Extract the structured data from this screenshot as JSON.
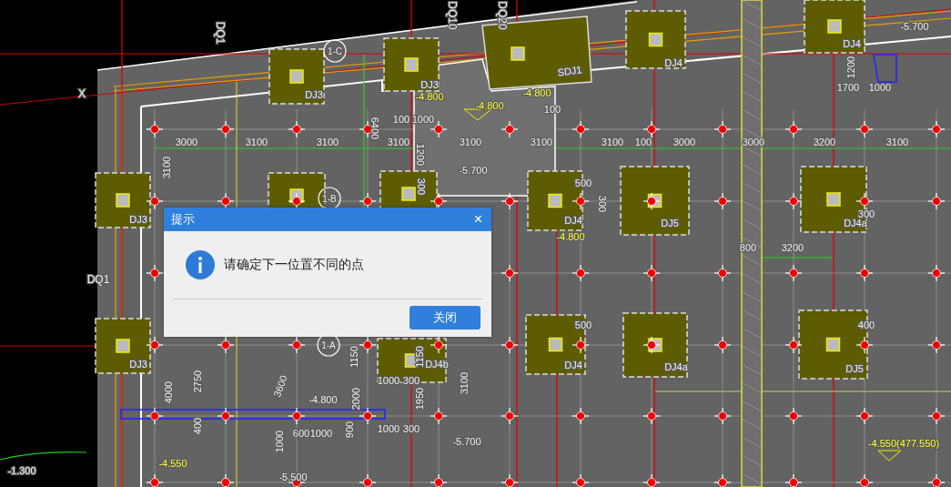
{
  "drawing": {
    "labels": [
      {
        "kind": "tag",
        "text": "DQ1"
      },
      {
        "kind": "tag",
        "text": "DQ10"
      },
      {
        "kind": "tag",
        "text": "DQ20"
      },
      {
        "kind": "tag",
        "text": "X"
      },
      {
        "kind": "axis",
        "text": "1-C"
      },
      {
        "kind": "footing",
        "text": "DJ3"
      },
      {
        "kind": "footing",
        "text": "DJ3"
      },
      {
        "kind": "footing",
        "text": "SDJ1"
      },
      {
        "kind": "footing",
        "text": "DJ4"
      },
      {
        "kind": "footing",
        "text": "DJ4"
      },
      {
        "kind": "level_white",
        "text": "-5.700"
      },
      {
        "kind": "level_yellow",
        "text": "-4.800"
      },
      {
        "kind": "level_yellow",
        "text": "-4.800"
      },
      {
        "kind": "level_yellow",
        "text": "-4.800"
      },
      {
        "kind": "dimension",
        "text": "1200"
      },
      {
        "kind": "dimension",
        "text": "1700"
      },
      {
        "kind": "dimension",
        "text": "1000"
      },
      {
        "kind": "dimension",
        "text": "100"
      },
      {
        "kind": "dimension",
        "text": "1000"
      },
      {
        "kind": "dimension",
        "text": "100"
      },
      {
        "kind": "dimension",
        "text": "6400"
      },
      {
        "kind": "dimension",
        "text": "3000"
      },
      {
        "kind": "dimension",
        "text": "3100"
      },
      {
        "kind": "dimension",
        "text": "3100"
      },
      {
        "kind": "dimension",
        "text": "3100"
      },
      {
        "kind": "dimension",
        "text": "3100"
      },
      {
        "kind": "dimension",
        "text": "3100"
      },
      {
        "kind": "dimension",
        "text": "3100"
      },
      {
        "kind": "dimension",
        "text": "100"
      },
      {
        "kind": "dimension",
        "text": "3000"
      },
      {
        "kind": "dimension",
        "text": "3000"
      },
      {
        "kind": "dimension",
        "text": "3200"
      },
      {
        "kind": "dimension",
        "text": "3100"
      },
      {
        "kind": "dimension",
        "text": "3100"
      },
      {
        "kind": "dimension",
        "text": "1200"
      },
      {
        "kind": "level_white",
        "text": "-5.700"
      },
      {
        "kind": "dimension",
        "text": "300"
      },
      {
        "kind": "axis",
        "text": "1-B"
      },
      {
        "kind": "footing",
        "text": "DJ3"
      },
      {
        "kind": "dimension",
        "text": "500"
      },
      {
        "kind": "dimension",
        "text": "300"
      },
      {
        "kind": "footing",
        "text": "DJ4"
      },
      {
        "kind": "footing",
        "text": "DJ5"
      },
      {
        "kind": "footing",
        "text": "DJ4a"
      },
      {
        "kind": "dimension",
        "text": "300"
      },
      {
        "kind": "level_yellow",
        "text": "-4.800"
      },
      {
        "kind": "dimension",
        "text": "800"
      },
      {
        "kind": "dimension",
        "text": "3200"
      },
      {
        "kind": "tag",
        "text": "DQ1"
      },
      {
        "kind": "dimension",
        "text": "500"
      },
      {
        "kind": "dimension",
        "text": "400"
      },
      {
        "kind": "axis",
        "text": "1-A"
      },
      {
        "kind": "footing",
        "text": "DJ3"
      },
      {
        "kind": "footing",
        "text": "DJ4"
      },
      {
        "kind": "footing",
        "text": "DJ4a"
      },
      {
        "kind": "footing",
        "text": "DJ5"
      },
      {
        "kind": "footing",
        "text": "DJ4b"
      },
      {
        "kind": "dimension",
        "text": "1150"
      },
      {
        "kind": "dimension",
        "text": "1150"
      },
      {
        "kind": "dimension",
        "text": "2750"
      },
      {
        "kind": "dimension",
        "text": "4000"
      },
      {
        "kind": "dimension",
        "text": "3600"
      },
      {
        "kind": "level_white",
        "text": "-4.800"
      },
      {
        "kind": "dimension",
        "text": "1000"
      },
      {
        "kind": "dimension",
        "text": "300"
      },
      {
        "kind": "dimension",
        "text": "2000"
      },
      {
        "kind": "dimension",
        "text": "1950"
      },
      {
        "kind": "dimension",
        "text": "3100"
      },
      {
        "kind": "dimension",
        "text": "400"
      },
      {
        "kind": "dimension",
        "text": "600"
      },
      {
        "kind": "dimension",
        "text": "1000"
      },
      {
        "kind": "dimension",
        "text": "900"
      },
      {
        "kind": "dimension",
        "text": "1000"
      },
      {
        "kind": "dimension",
        "text": "300"
      },
      {
        "kind": "level_white",
        "text": "-5.700"
      },
      {
        "kind": "dimension",
        "text": "1000"
      },
      {
        "kind": "level_yellow",
        "text": "-4.550"
      },
      {
        "kind": "level_white",
        "text": "-1.300"
      },
      {
        "kind": "level_white",
        "text": "-5.500"
      },
      {
        "kind": "level_yellow",
        "text": "-4.550(477.550)"
      }
    ]
  },
  "dialog": {
    "title": "提示",
    "close": "×",
    "message": "请确定下一位置不同的点",
    "button": "关闭"
  }
}
